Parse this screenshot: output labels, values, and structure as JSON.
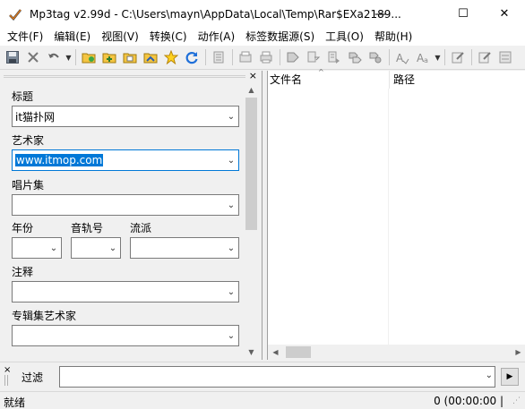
{
  "window": {
    "title": "Mp3tag v2.99d  -  C:\\Users\\mayn\\AppData\\Local\\Temp\\Rar$EXa2189...",
    "minimize": "—",
    "maximize": "☐",
    "close": "✕"
  },
  "menu": [
    "文件(F)",
    "编辑(E)",
    "视图(V)",
    "转换(C)",
    "动作(A)",
    "标签数据源(S)",
    "工具(O)",
    "帮助(H)"
  ],
  "toolbar": {
    "icons": [
      "save-icon",
      "remove-tag-icon",
      "undo-icon",
      "change-folder-icon",
      "add-folder-icon",
      "open-folder-icon",
      "favorites-icon",
      "refresh-icon",
      "tag-sources-icon",
      "export-icon",
      "print-icon",
      "tag-to-filename-icon",
      "filename-to-tag-icon",
      "text-file-to-tag-icon",
      "tag-to-tag-icon",
      "actions-icon",
      "case-conversion-icon",
      "action-group-icon",
      "edit-icon",
      "settings-icon"
    ]
  },
  "tag_panel": {
    "close": "×",
    "fields": {
      "title": {
        "label": "标题",
        "value": "it猫扑网"
      },
      "artist": {
        "label": "艺术家",
        "value": "www.itmop.com"
      },
      "album": {
        "label": "唱片集",
        "value": ""
      },
      "year": {
        "label": "年份",
        "value": ""
      },
      "track": {
        "label": "音轨号",
        "value": ""
      },
      "genre": {
        "label": "流派",
        "value": ""
      },
      "comment": {
        "label": "注释",
        "value": ""
      },
      "album_artist": {
        "label": "专辑集艺术家",
        "value": ""
      }
    }
  },
  "file_list": {
    "columns": [
      "文件名",
      "路径"
    ]
  },
  "filter": {
    "close": "×",
    "label": "过滤",
    "value": "",
    "go": "▶"
  },
  "status": {
    "left": "就绪",
    "right": "0 (00:00:00 |"
  },
  "colors": {
    "selection": "#0078d7",
    "window_bg": "#f0f0f0"
  }
}
